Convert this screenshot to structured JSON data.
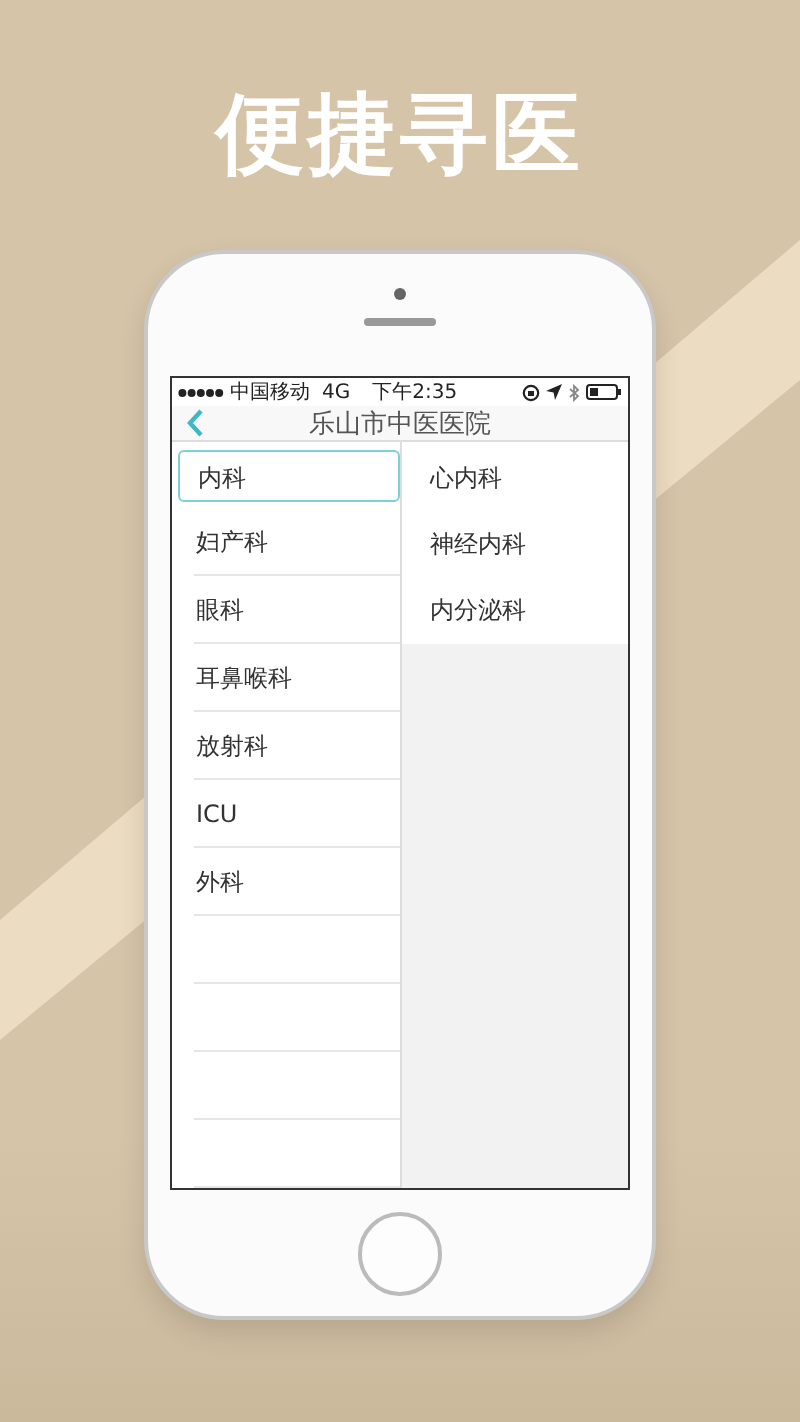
{
  "headline": "便捷寻医",
  "status_bar": {
    "carrier": "中国移动",
    "network": "4G",
    "time": "下午2:35"
  },
  "nav": {
    "title": "乐山市中医医院"
  },
  "departments": [
    {
      "label": "内科",
      "selected": true
    },
    {
      "label": "妇产科",
      "selected": false
    },
    {
      "label": "眼科",
      "selected": false
    },
    {
      "label": "耳鼻喉科",
      "selected": false
    },
    {
      "label": "放射科",
      "selected": false
    },
    {
      "label": "ICU",
      "selected": false
    },
    {
      "label": "外科",
      "selected": false
    }
  ],
  "subdepartments": [
    {
      "label": "心内科"
    },
    {
      "label": "神经内科"
    },
    {
      "label": "内分泌科"
    }
  ]
}
